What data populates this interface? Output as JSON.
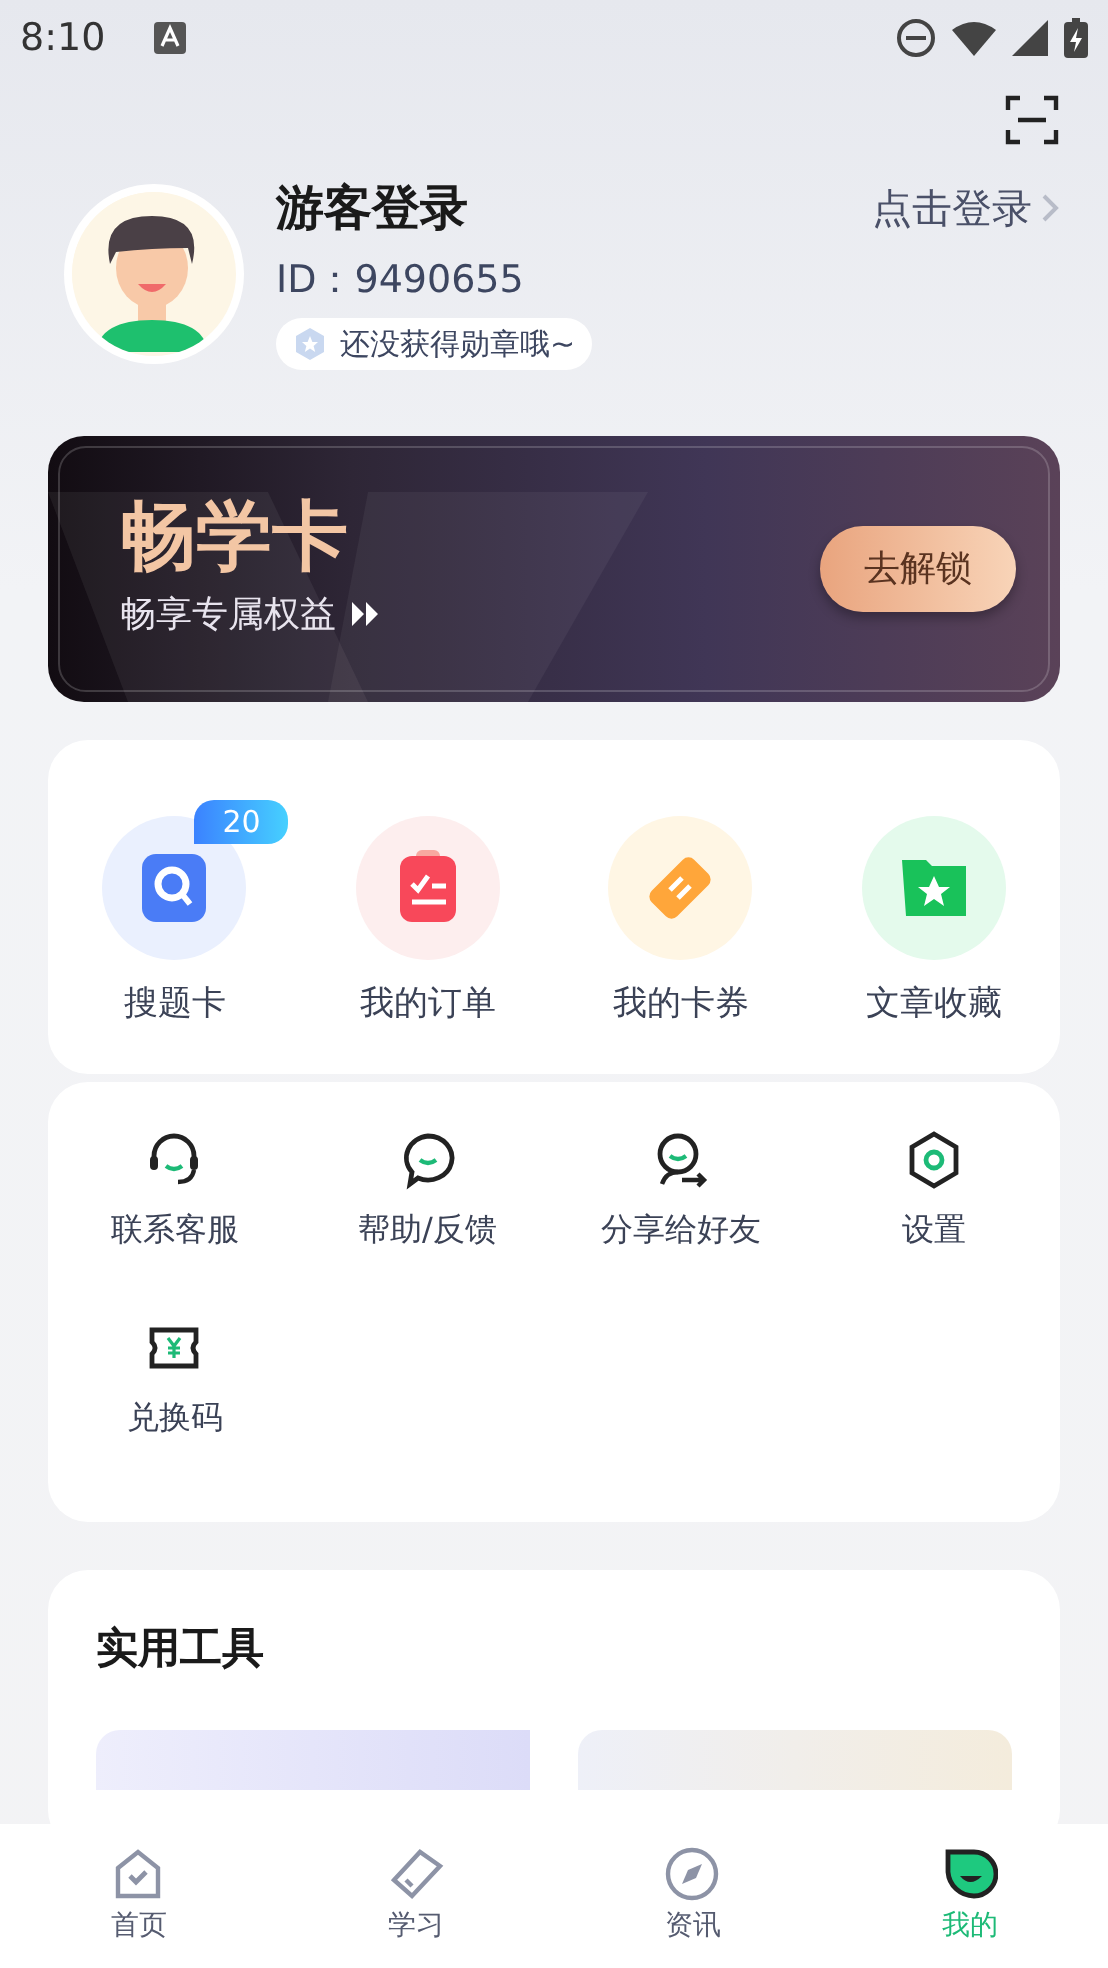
{
  "status_bar": {
    "time": "8:10"
  },
  "profile": {
    "name": "游客登录",
    "id": "ID：9490655",
    "badge": "还没获得勋章哦~",
    "login_link": "点击登录"
  },
  "vip_card": {
    "title": "畅学卡",
    "subtitle": "畅享专属权益",
    "button": "去解锁"
  },
  "quick_actions": [
    {
      "label": "搜题卡",
      "kind": "search",
      "badge": "20"
    },
    {
      "label": "我的订单",
      "kind": "order"
    },
    {
      "label": "我的卡券",
      "kind": "coupon"
    },
    {
      "label": "文章收藏",
      "kind": "favorite"
    }
  ],
  "services": [
    {
      "label": "联系客服",
      "kind": "headset"
    },
    {
      "label": "帮助/反馈",
      "kind": "chat"
    },
    {
      "label": "分享给好友",
      "kind": "share"
    },
    {
      "label": "设置",
      "kind": "settings"
    },
    {
      "label": "兑换码",
      "kind": "ticket"
    }
  ],
  "tools": {
    "title": "实用工具"
  },
  "tab_bar": [
    {
      "label": "首页",
      "kind": "home",
      "selected": false
    },
    {
      "label": "学习",
      "kind": "study",
      "selected": false
    },
    {
      "label": "资讯",
      "kind": "news",
      "selected": false
    },
    {
      "label": "我的",
      "kind": "me",
      "selected": true
    }
  ]
}
